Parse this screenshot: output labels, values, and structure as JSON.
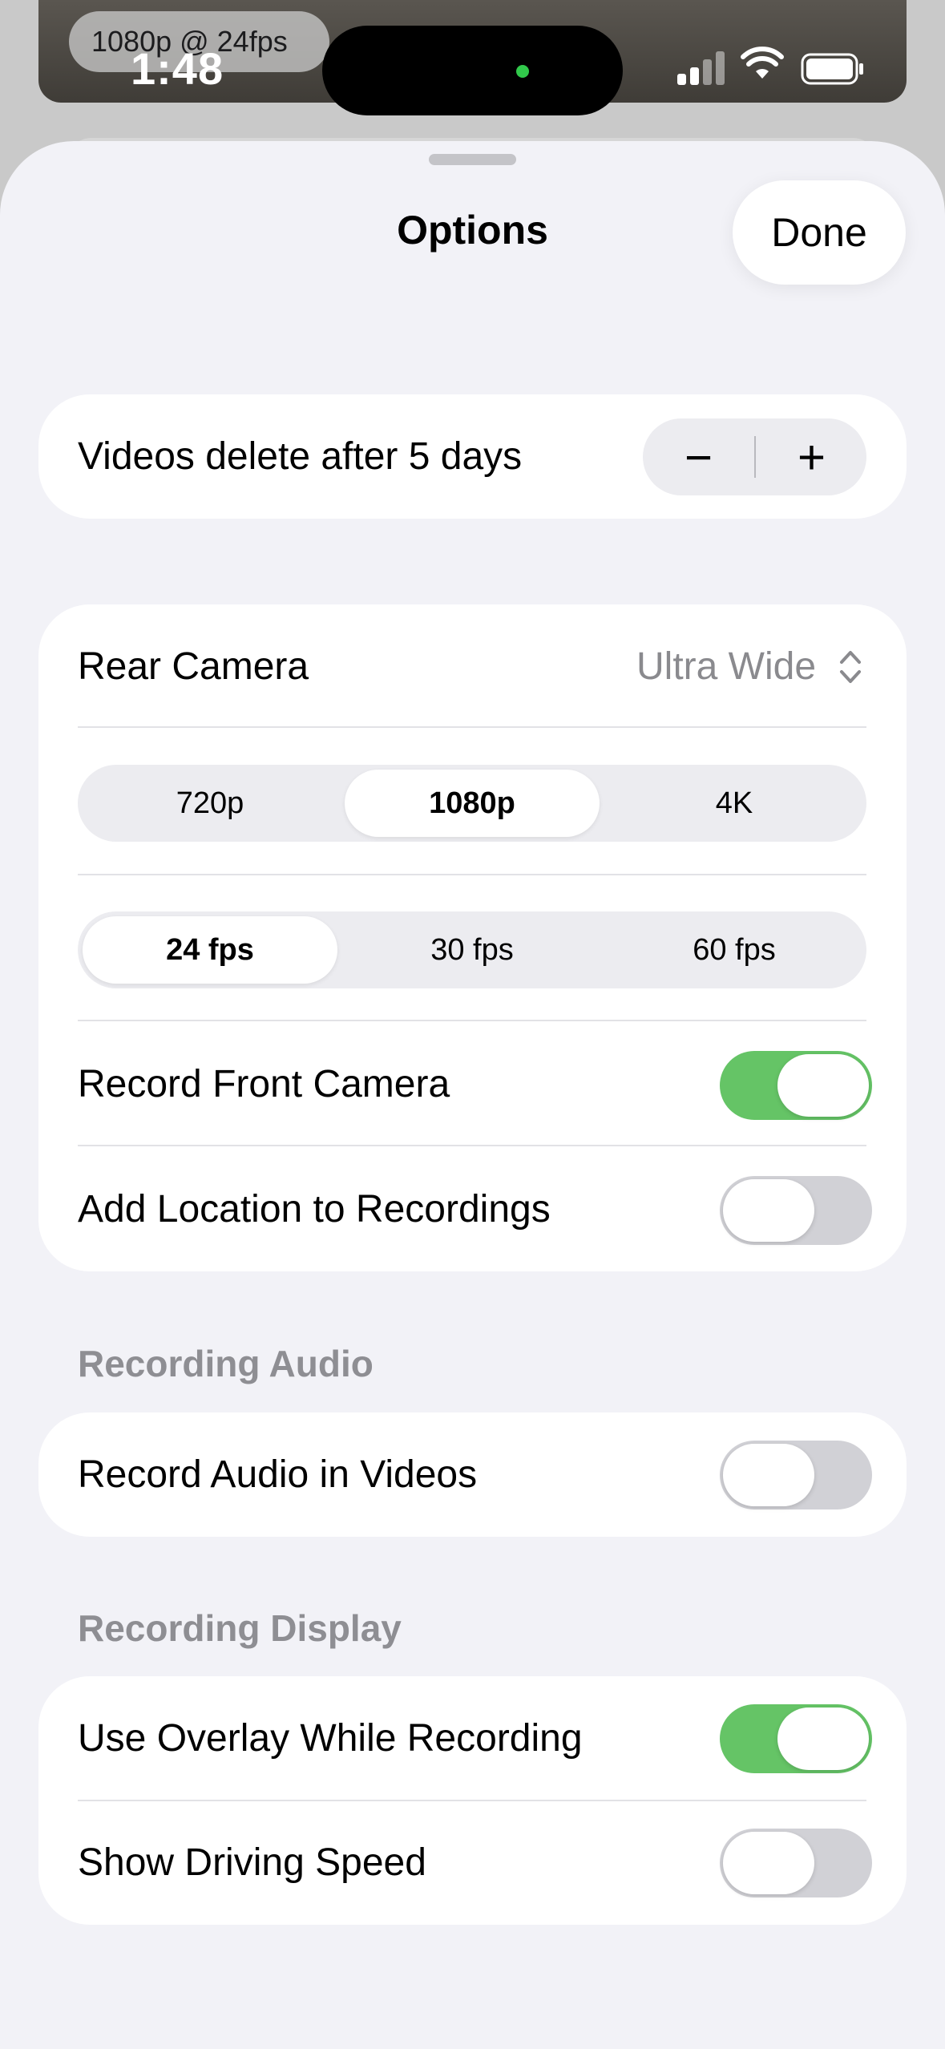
{
  "status_bar": {
    "time": "1:48",
    "overlay_badge": "1080p @ 24fps",
    "icons": [
      "cellular-signal-icon",
      "wifi-icon",
      "battery-icon"
    ]
  },
  "sheet": {
    "title": "Options",
    "done_label": "Done"
  },
  "retention": {
    "label": "Videos delete after 5 days",
    "minus": "−",
    "plus": "+"
  },
  "camera": {
    "rear_label": "Rear Camera",
    "rear_value": "Ultra Wide",
    "resolution_options": [
      "720p",
      "1080p",
      "4K"
    ],
    "resolution_selected": "1080p",
    "fps_options": [
      "24 fps",
      "30 fps",
      "60 fps"
    ],
    "fps_selected": "24 fps",
    "record_front_label": "Record Front Camera",
    "record_front_on": true,
    "location_label": "Add Location to Recordings",
    "location_on": false
  },
  "audio": {
    "header": "Recording Audio",
    "record_audio_label": "Record Audio in Videos",
    "record_audio_on": false
  },
  "display": {
    "header": "Recording Display",
    "overlay_label": "Use Overlay While Recording",
    "overlay_on": true,
    "speed_label": "Show Driving Speed",
    "speed_on": false
  },
  "colors": {
    "toggle_on": "#65c466",
    "toggle_off": "#d1d1d6",
    "background": "#f2f2f7"
  }
}
